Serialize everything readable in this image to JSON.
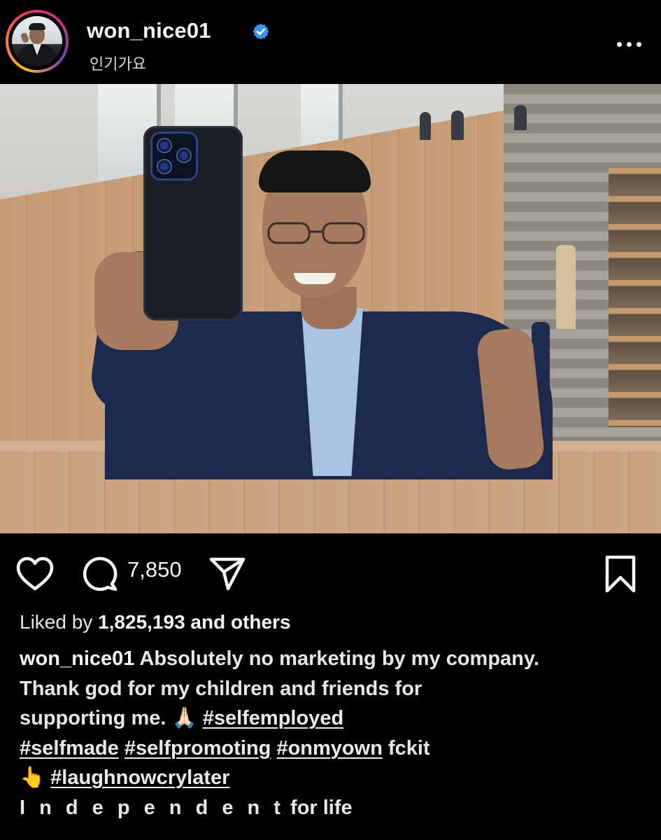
{
  "header": {
    "username": "won_nice01",
    "subtitle": "인기가요",
    "verified": true,
    "avatar_icon": "profile-photo",
    "more_icon": "ellipsis-icon"
  },
  "post": {
    "image_alt": "selfie photo",
    "actions": {
      "like_icon": "heart-icon",
      "comment_icon": "comment-bubble-icon",
      "comment_count": "7,850",
      "share_icon": "paper-plane-icon",
      "save_icon": "bookmark-icon"
    },
    "likes": {
      "prefix": "Liked by",
      "count_text": "1,825,193 and others"
    },
    "caption": {
      "username": "won_nice01",
      "line1_text": "Absolutely no marketing by my company.",
      "line2": "Thank god for my children and friends for",
      "line3_text": "supporting me.",
      "emoji_pray": "🙏🏻",
      "tag_selfemployed": "#selfemployed",
      "tag_selfmade": "#selfmade",
      "tag_selfpromoting": "#selfpromoting",
      "tag_onmyown": "#onmyown",
      "word_fckit": "fckit",
      "emoji_point": "👆",
      "tag_laughnowcrylater": "#laughnowcrylater",
      "last_line_spaced": "I n d e p e n d e n t",
      "last_line_end": "for life"
    }
  },
  "colors": {
    "background": "#000000",
    "text": "#f5f5f5",
    "verified_blue": "#3897f0"
  }
}
